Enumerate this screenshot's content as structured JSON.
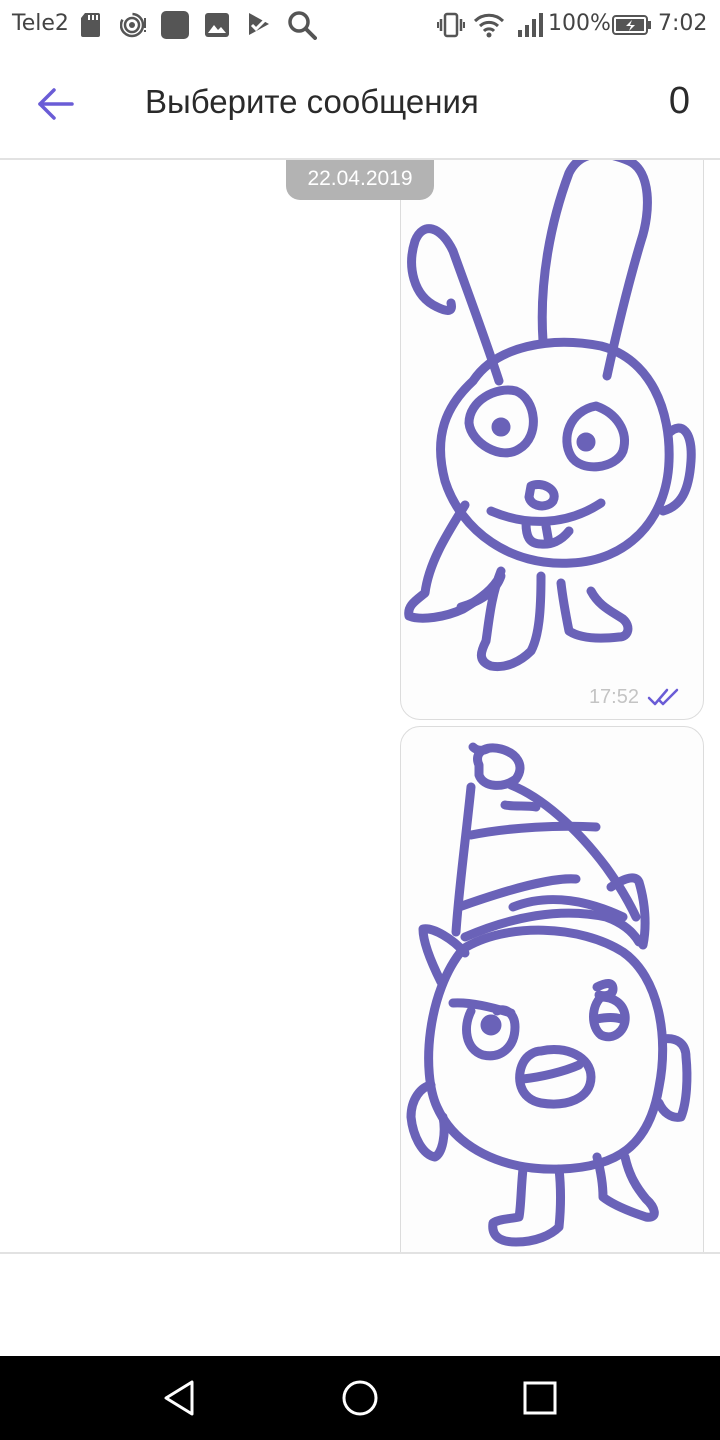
{
  "status_bar": {
    "carrier": "Tele2",
    "battery_percent": "100%",
    "time": "7:02",
    "left_icons": [
      "sd-card-icon",
      "hotspot-icon",
      "app-square-icon",
      "gallery-icon",
      "play-store-icon",
      "search-icon"
    ],
    "right_icons": [
      "vibrate-icon",
      "wifi-icon",
      "signal-icon",
      "battery-icon"
    ]
  },
  "app_bar": {
    "back_icon": "arrow-left-icon",
    "title": "Выберите сообщения",
    "selected_count": "0"
  },
  "conversation": {
    "date_separator": "22.04.2019",
    "messages": [
      {
        "type": "doodle",
        "subject": "bunny",
        "time": "17:52",
        "status_icon": "double-check-icon"
      },
      {
        "type": "doodle",
        "subject": "creature-in-hat",
        "time": "",
        "status_icon": ""
      }
    ]
  },
  "navigation_bar": {
    "buttons": [
      "back-triangle-icon",
      "home-circle-icon",
      "recents-square-icon"
    ]
  },
  "colors": {
    "accent": "#6a5cd6",
    "doodle_stroke": "#6a62b8",
    "date_chip": "#b3b3b3",
    "navbar": "#000000"
  }
}
